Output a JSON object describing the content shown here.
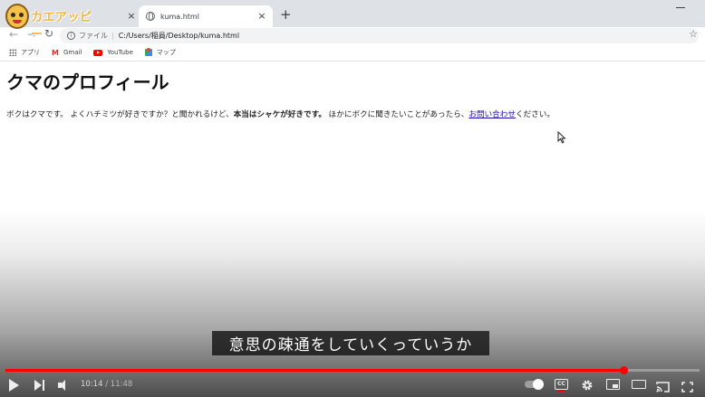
{
  "browser": {
    "tabs": [
      {
        "label": "",
        "close_glyph": "×"
      },
      {
        "label": "kuma.html",
        "close_glyph": "×"
      }
    ],
    "new_tab_glyph": "+",
    "nav": {
      "back_glyph": "←",
      "forward_glyph": "→",
      "reload_glyph": "↻"
    },
    "address": {
      "site_label": "ファイル",
      "separator": "|",
      "url": "C:/Users/稲員/Desktop/kuma.html"
    },
    "star_glyph": "☆",
    "bookmarks": [
      {
        "label": "アプリ",
        "icon": "apps-grid-icon"
      },
      {
        "label": "Gmail",
        "icon": "gmail-icon"
      },
      {
        "label": "YouTube",
        "icon": "youtube-icon"
      },
      {
        "label": "マップ",
        "icon": "maps-icon"
      }
    ]
  },
  "logo": {
    "text": "カエアッピー"
  },
  "page": {
    "heading": "クマのプロフィール",
    "para_part1": "ボクはクマです。 よくハチミツが好きですか？と聞かれるけど、",
    "para_bold": "本当はシャケが好きです。",
    "para_part2": " ほかにボクに聞きたいことがあったら、",
    "para_link": "お問い合わせ",
    "para_part3": "ください。"
  },
  "video": {
    "caption": "意思の疎通をしていくっていうか",
    "current_time": "10:14",
    "time_separator": " / ",
    "duration": "11:48",
    "progress": 0.8903,
    "accent_color": "#ff0000"
  }
}
